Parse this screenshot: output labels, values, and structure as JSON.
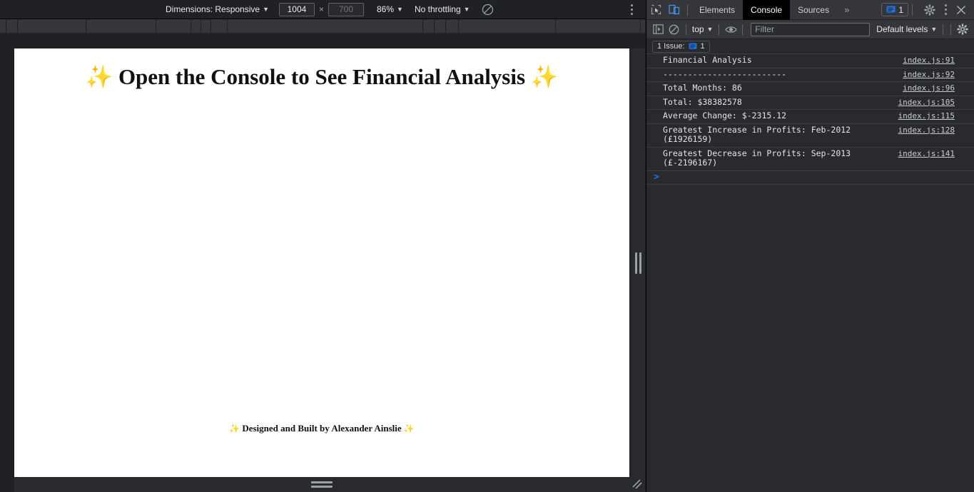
{
  "device_toolbar": {
    "dimensions_label": "Dimensions: Responsive",
    "width_value": "1004",
    "height_placeholder": "700",
    "times": "×",
    "zoom_label": "86%",
    "throttling_label": "No throttling",
    "rotate_icon": "rotate-icon",
    "menu_icon": "more-options-icon"
  },
  "page": {
    "sparkle": "✨",
    "heading": "Open the Console to See Financial Analysis",
    "footer": "Designed and Built by Alexander Ainslie"
  },
  "devtools": {
    "inspect_icon": "inspect-element-icon",
    "device_toggle_icon": "device-toolbar-icon",
    "tabs": [
      {
        "label": "Elements",
        "active": false
      },
      {
        "label": "Console",
        "active": true
      },
      {
        "label": "Sources",
        "active": false
      }
    ],
    "more_tabs": "»",
    "issue_badge_count": "1",
    "issue_badge_icon": "message-bubble-icon",
    "gear_icon": "settings-gear-icon",
    "kebab_icon": "more-options-icon",
    "close_icon": "close-icon"
  },
  "console_toolbar": {
    "clear_console_icon": "clear-console-icon",
    "no_entry_icon": "no-entry-icon",
    "context_label": "top",
    "eye_icon": "live-expressions-eye-icon",
    "filter_placeholder": "Filter",
    "filter_value": "",
    "levels_label": "Default levels",
    "settings_icon": "console-settings-gear-icon"
  },
  "issues_bar": {
    "text": "1 Issue:",
    "icon": "message-bubble-icon",
    "count": "1"
  },
  "console_messages": [
    {
      "text": "Financial Analysis",
      "source": "index.js:91"
    },
    {
      "text": "-------------------------",
      "source": "index.js:92"
    },
    {
      "text": "Total Months: 86",
      "source": "index.js:96"
    },
    {
      "text": "Total: $38382578",
      "source": "index.js:105"
    },
    {
      "text": "Average Change: $-2315.12",
      "source": "index.js:115"
    },
    {
      "text": "Greatest Increase in Profits: Feb-2012 (£1926159)",
      "source": "index.js:128"
    },
    {
      "text": "Greatest Decrease in Profits: Sep-2013 (£-2196167)",
      "source": "index.js:141"
    }
  ],
  "console_prompt": {
    "arrow": "›"
  },
  "colors": {
    "devtools_bg": "#282a2d",
    "toolbar_bg": "#35363a",
    "accent_blue": "#1a73e8",
    "sparkle_gold": "#f6c544",
    "page_bg": "#ffffff"
  }
}
